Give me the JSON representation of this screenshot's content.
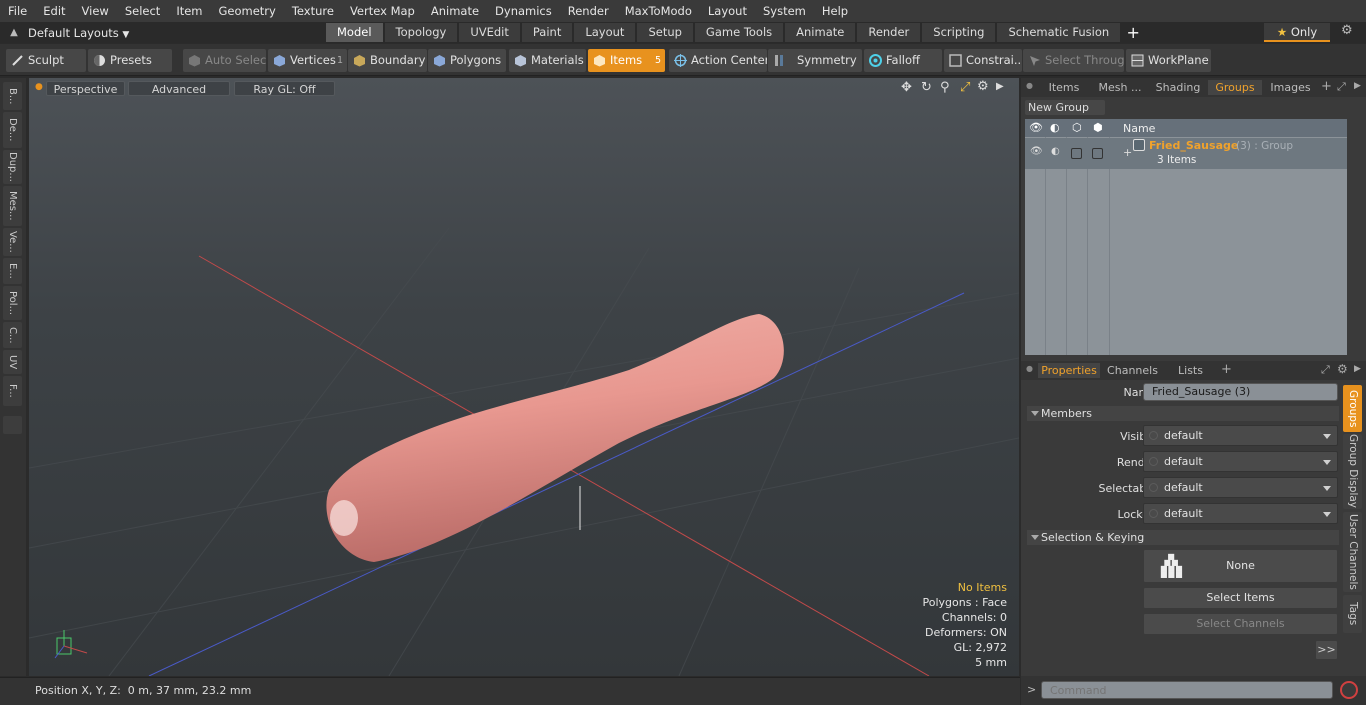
{
  "menu": [
    "File",
    "Edit",
    "View",
    "Select",
    "Item",
    "Geometry",
    "Texture",
    "Vertex Map",
    "Animate",
    "Dynamics",
    "Render",
    "MaxToModo",
    "Layout",
    "System",
    "Help"
  ],
  "layouts": {
    "dropdown_label": "Default Layouts",
    "tabs": [
      "Model",
      "Topology",
      "UVEdit",
      "Paint",
      "Layout",
      "Setup",
      "Game Tools",
      "Animate",
      "Render",
      "Scripting",
      "Schematic Fusion"
    ],
    "active_tab": "Model",
    "only_label": "Only"
  },
  "toolbar": {
    "sculpt": "Sculpt",
    "presets": "Presets",
    "auto_select": "Auto Select",
    "vertices": "Vertices",
    "vertices_count": "1",
    "boundary": "Boundary",
    "polygons": "Polygons",
    "materials": "Materials",
    "items": "Items",
    "items_count": "5",
    "action_center": "Action Center",
    "symmetry": "Symmetry",
    "falloff": "Falloff",
    "constraints": "Constrai...",
    "select_through": "Select Through",
    "workplane": "WorkPlane"
  },
  "left_tabs": [
    "B...",
    "De...",
    "Dup...",
    "Mes...",
    "Ve...",
    "E...",
    "Pol...",
    "C...",
    "UV",
    "F..."
  ],
  "viewport": {
    "perspective": "Perspective",
    "advanced": "Advanced",
    "raygl": "Ray GL: Off",
    "info": {
      "no_items": "No Items",
      "polygons": "Polygons : Face",
      "channels": "Channels: 0",
      "deformers": "Deformers: ON",
      "gl": "GL: 2,972",
      "scale": "5 mm"
    }
  },
  "status": {
    "position": "Position X, Y, Z:  0 m, 37 mm, 23.2 mm"
  },
  "groups_panel": {
    "tabs": [
      "Items",
      "Mesh ...",
      "Shading",
      "Groups",
      "Images"
    ],
    "active_tab": "Groups",
    "new_group": "New Group",
    "col_name": "Name",
    "row": {
      "name": "Fried_Sausage",
      "suffix": "(3) : Group",
      "count": "3 Items"
    }
  },
  "properties_panel": {
    "tabs": [
      "Properties",
      "Channels",
      "Lists"
    ],
    "active_tab": "Properties",
    "name_label": "Name",
    "name_value": "Fried_Sausage (3)",
    "members_section": "Members",
    "fields": [
      {
        "label": "Visible",
        "value": "default"
      },
      {
        "label": "Render",
        "value": "default"
      },
      {
        "label": "Selectable",
        "value": "default"
      },
      {
        "label": "Locked",
        "value": "default"
      }
    ],
    "selection_section": "Selection & Keying",
    "none_button": "None",
    "select_items": "Select Items",
    "select_channels": "Select Channels",
    "more_button": ">>",
    "side_tabs": [
      "Groups",
      "Group Display",
      "User Channels",
      "Tags"
    ]
  },
  "command": {
    "prompt": ">",
    "placeholder": "Command"
  },
  "colors": {
    "accent": "#e8921e",
    "group_name": "#f0a22c",
    "panel": "#3a3a3a"
  }
}
